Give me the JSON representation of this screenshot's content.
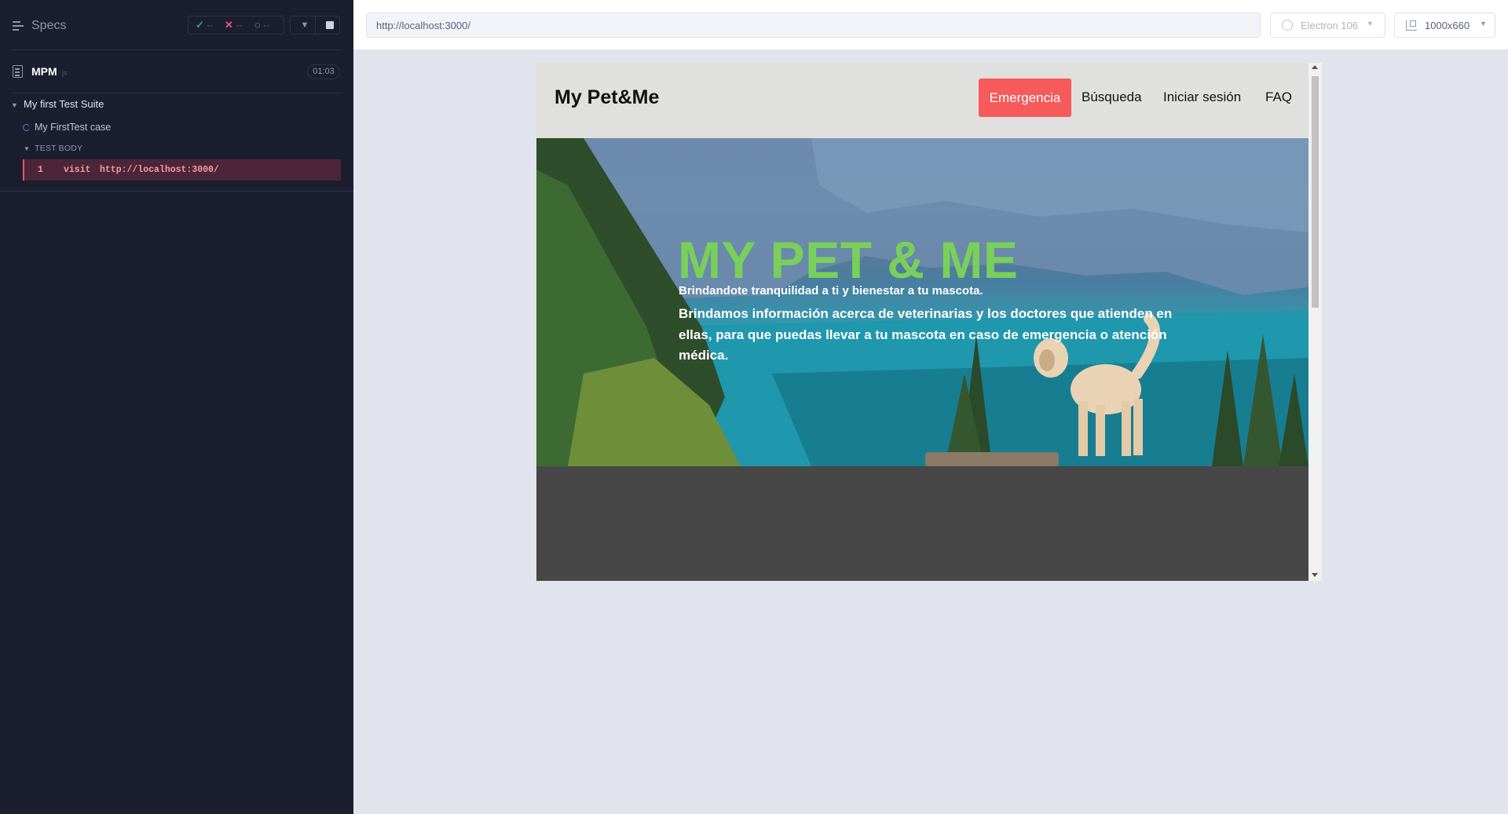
{
  "reporter": {
    "specs_label": "Specs",
    "stats": {
      "passed": "--",
      "failed": "--",
      "pending": "--"
    },
    "spec": {
      "name": "MPM",
      "ext": "js",
      "duration": "01:03"
    },
    "suite": {
      "title": "My first Test Suite"
    },
    "test_case": {
      "title": "My FirstTest case"
    },
    "body_label": "TEST BODY",
    "command": {
      "number": "1",
      "name": "visit",
      "message": "http://localhost:3000/"
    }
  },
  "topbar": {
    "url": "http://localhost:3000/",
    "browser": "Electron 106",
    "viewport": "1000x660"
  },
  "aut": {
    "brand": "My Pet&Me",
    "nav": {
      "emergencia": "Emergencia",
      "busqueda": "Búsqueda",
      "login": "Iniciar sesión",
      "faq": "FAQ"
    },
    "hero": {
      "title": "MY PET & ME",
      "tagline": "Brindandote tranquilidad a ti y bienestar a tu mascota.",
      "description": "Brindamos información acerca de veterinarias y los doctores que atienden en ellas, para que puedas llevar a tu mascota en caso de emergencia o atención médica."
    }
  },
  "colors": {
    "reporter_bg": "#1b1e2e",
    "pass": "#1fa971",
    "fail": "#e45770",
    "emergency_button": "#f65a5a",
    "hero_title": "#78d05a"
  },
  "icons": [
    "specs-icon",
    "check-icon",
    "x-icon",
    "spinner-icon",
    "chevron-down-icon",
    "stop-icon",
    "file-icon",
    "browser-icon",
    "viewport-icon"
  ]
}
